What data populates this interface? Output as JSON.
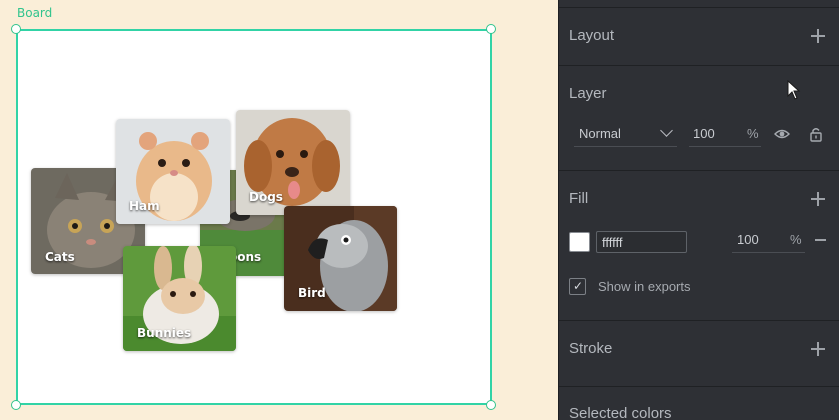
{
  "canvas": {
    "board_label": "Board",
    "board_fill": "#ffffff",
    "photos": [
      {
        "label": "Cats"
      },
      {
        "label": "Ham"
      },
      {
        "label": "Dogs"
      },
      {
        "label": "oons"
      },
      {
        "label": "Bird"
      },
      {
        "label": "Bunnies"
      }
    ]
  },
  "panel": {
    "layout": {
      "title": "Layout"
    },
    "layer": {
      "title": "Layer",
      "blend_mode": "Normal",
      "opacity": "100",
      "opacity_unit": "%"
    },
    "fill": {
      "title": "Fill",
      "hex": "ffffff",
      "opacity": "100",
      "opacity_unit": "%",
      "show_in_exports_label": "Show in exports",
      "show_in_exports": true,
      "check_mark": "✓"
    },
    "stroke": {
      "title": "Stroke"
    },
    "selected_colors": {
      "title": "Selected colors"
    }
  },
  "colors": {
    "accent": "#31c48d",
    "panel_bg": "#2e3035",
    "canvas_bg": "#faeed8"
  }
}
